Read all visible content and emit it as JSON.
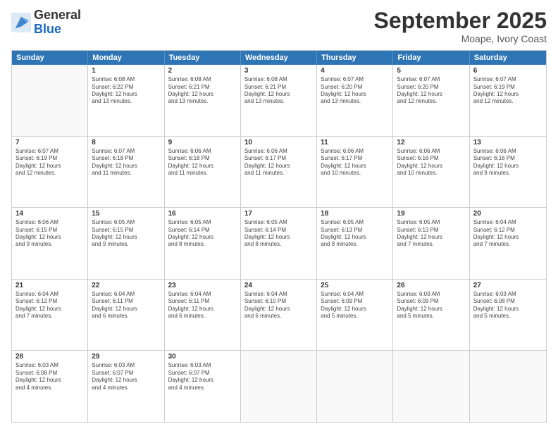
{
  "header": {
    "logo_general": "General",
    "logo_blue": "Blue",
    "month_title": "September 2025",
    "subtitle": "Moape, Ivory Coast"
  },
  "day_headers": [
    "Sunday",
    "Monday",
    "Tuesday",
    "Wednesday",
    "Thursday",
    "Friday",
    "Saturday"
  ],
  "weeks": [
    [
      {
        "day": "",
        "info": ""
      },
      {
        "day": "1",
        "info": "Sunrise: 6:08 AM\nSunset: 6:22 PM\nDaylight: 12 hours\nand 13 minutes."
      },
      {
        "day": "2",
        "info": "Sunrise: 6:08 AM\nSunset: 6:21 PM\nDaylight: 12 hours\nand 13 minutes."
      },
      {
        "day": "3",
        "info": "Sunrise: 6:08 AM\nSunset: 6:21 PM\nDaylight: 12 hours\nand 13 minutes."
      },
      {
        "day": "4",
        "info": "Sunrise: 6:07 AM\nSunset: 6:20 PM\nDaylight: 12 hours\nand 13 minutes."
      },
      {
        "day": "5",
        "info": "Sunrise: 6:07 AM\nSunset: 6:20 PM\nDaylight: 12 hours\nand 12 minutes."
      },
      {
        "day": "6",
        "info": "Sunrise: 6:07 AM\nSunset: 6:19 PM\nDaylight: 12 hours\nand 12 minutes."
      }
    ],
    [
      {
        "day": "7",
        "info": "Sunrise: 6:07 AM\nSunset: 6:19 PM\nDaylight: 12 hours\nand 12 minutes."
      },
      {
        "day": "8",
        "info": "Sunrise: 6:07 AM\nSunset: 6:18 PM\nDaylight: 12 hours\nand 11 minutes."
      },
      {
        "day": "9",
        "info": "Sunrise: 6:06 AM\nSunset: 6:18 PM\nDaylight: 12 hours\nand 11 minutes."
      },
      {
        "day": "10",
        "info": "Sunrise: 6:06 AM\nSunset: 6:17 PM\nDaylight: 12 hours\nand 11 minutes."
      },
      {
        "day": "11",
        "info": "Sunrise: 6:06 AM\nSunset: 6:17 PM\nDaylight: 12 hours\nand 10 minutes."
      },
      {
        "day": "12",
        "info": "Sunrise: 6:06 AM\nSunset: 6:16 PM\nDaylight: 12 hours\nand 10 minutes."
      },
      {
        "day": "13",
        "info": "Sunrise: 6:06 AM\nSunset: 6:16 PM\nDaylight: 12 hours\nand 9 minutes."
      }
    ],
    [
      {
        "day": "14",
        "info": "Sunrise: 6:06 AM\nSunset: 6:15 PM\nDaylight: 12 hours\nand 9 minutes."
      },
      {
        "day": "15",
        "info": "Sunrise: 6:05 AM\nSunset: 6:15 PM\nDaylight: 12 hours\nand 9 minutes."
      },
      {
        "day": "16",
        "info": "Sunrise: 6:05 AM\nSunset: 6:14 PM\nDaylight: 12 hours\nand 8 minutes."
      },
      {
        "day": "17",
        "info": "Sunrise: 6:05 AM\nSunset: 6:14 PM\nDaylight: 12 hours\nand 8 minutes."
      },
      {
        "day": "18",
        "info": "Sunrise: 6:05 AM\nSunset: 6:13 PM\nDaylight: 12 hours\nand 8 minutes."
      },
      {
        "day": "19",
        "info": "Sunrise: 6:05 AM\nSunset: 6:13 PM\nDaylight: 12 hours\nand 7 minutes."
      },
      {
        "day": "20",
        "info": "Sunrise: 6:04 AM\nSunset: 6:12 PM\nDaylight: 12 hours\nand 7 minutes."
      }
    ],
    [
      {
        "day": "21",
        "info": "Sunrise: 6:04 AM\nSunset: 6:12 PM\nDaylight: 12 hours\nand 7 minutes."
      },
      {
        "day": "22",
        "info": "Sunrise: 6:04 AM\nSunset: 6:11 PM\nDaylight: 12 hours\nand 6 minutes."
      },
      {
        "day": "23",
        "info": "Sunrise: 6:04 AM\nSunset: 6:11 PM\nDaylight: 12 hours\nand 6 minutes."
      },
      {
        "day": "24",
        "info": "Sunrise: 6:04 AM\nSunset: 6:10 PM\nDaylight: 12 hours\nand 6 minutes."
      },
      {
        "day": "25",
        "info": "Sunrise: 6:04 AM\nSunset: 6:09 PM\nDaylight: 12 hours\nand 5 minutes."
      },
      {
        "day": "26",
        "info": "Sunrise: 6:03 AM\nSunset: 6:09 PM\nDaylight: 12 hours\nand 5 minutes."
      },
      {
        "day": "27",
        "info": "Sunrise: 6:03 AM\nSunset: 6:08 PM\nDaylight: 12 hours\nand 5 minutes."
      }
    ],
    [
      {
        "day": "28",
        "info": "Sunrise: 6:03 AM\nSunset: 6:08 PM\nDaylight: 12 hours\nand 4 minutes."
      },
      {
        "day": "29",
        "info": "Sunrise: 6:03 AM\nSunset: 6:07 PM\nDaylight: 12 hours\nand 4 minutes."
      },
      {
        "day": "30",
        "info": "Sunrise: 6:03 AM\nSunset: 6:07 PM\nDaylight: 12 hours\nand 4 minutes."
      },
      {
        "day": "",
        "info": ""
      },
      {
        "day": "",
        "info": ""
      },
      {
        "day": "",
        "info": ""
      },
      {
        "day": "",
        "info": ""
      }
    ]
  ]
}
